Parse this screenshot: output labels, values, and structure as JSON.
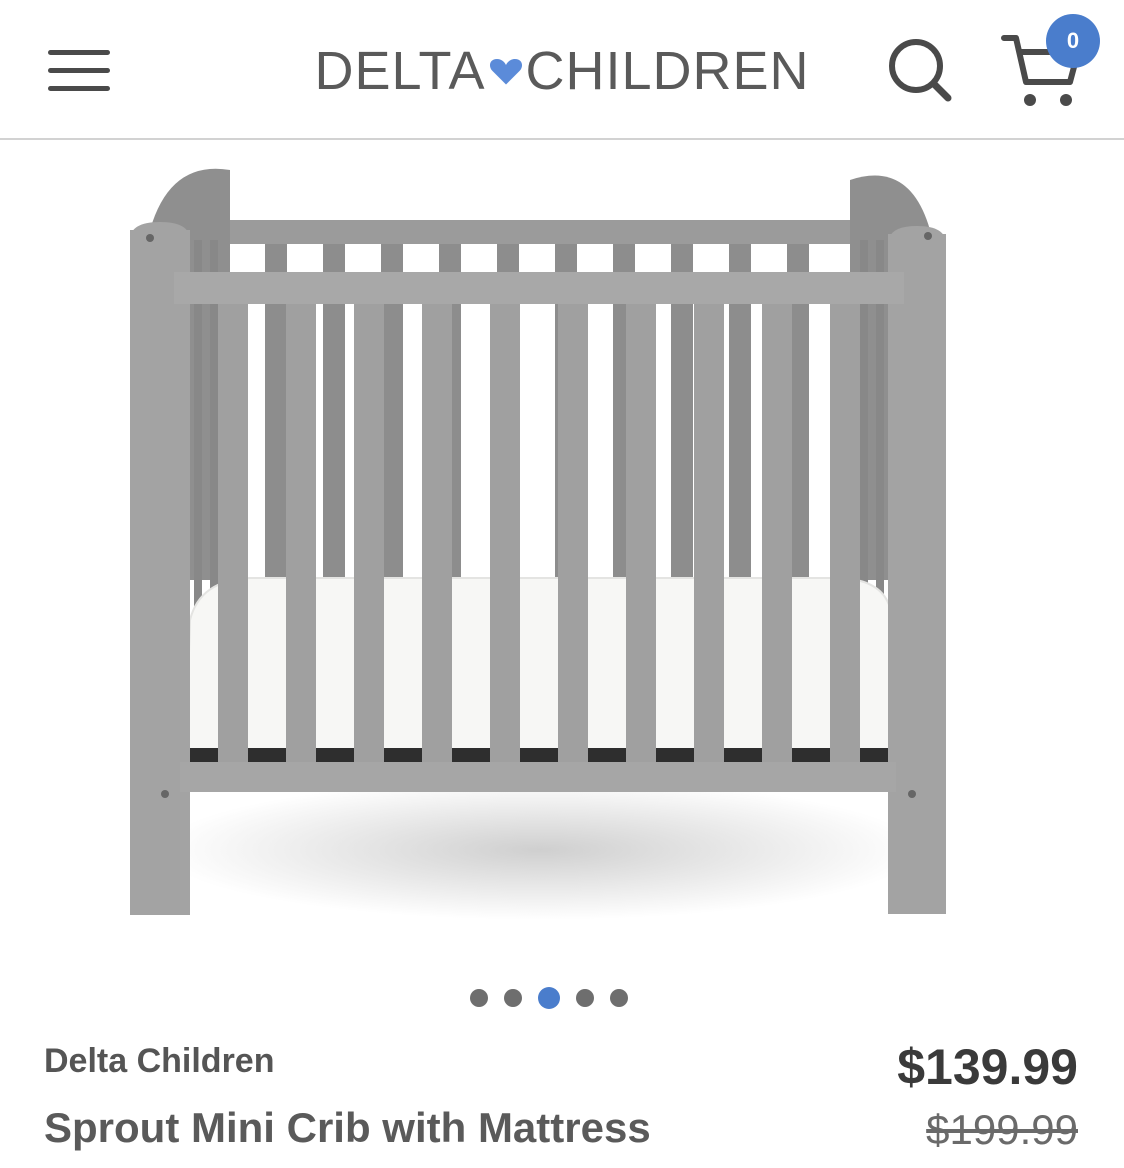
{
  "header": {
    "logo_left": "DELTA",
    "logo_right": "CHILDREN",
    "logo_heart_color": "#5b8bd9",
    "menu_icon": "hamburger-menu-icon",
    "search_icon": "search-icon",
    "cart_icon": "cart-icon",
    "cart_count": "0"
  },
  "carousel": {
    "total_slides": 5,
    "active_index": 2
  },
  "product": {
    "brand": "Delta Children",
    "name": "Sprout Mini Crib with Mattress",
    "price": "$139.99",
    "original_price": "$199.99"
  },
  "colors": {
    "accent": "#4a7dcc",
    "crib_gray": "#9a9a9a",
    "text_dark": "#3a3a3a"
  }
}
